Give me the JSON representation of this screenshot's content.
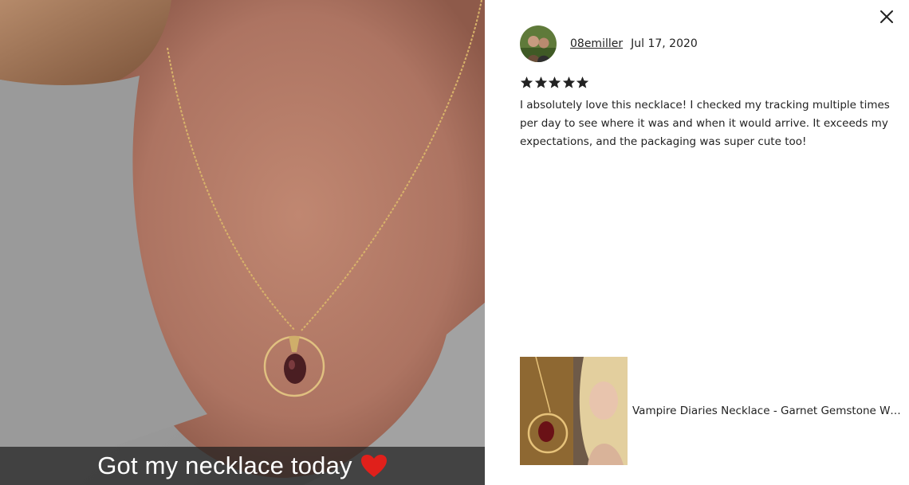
{
  "photo": {
    "caption": "Got my necklace today",
    "caption_emoji_icon": "red-heart-icon",
    "caption_colors": {
      "bar": "#1e1e1e",
      "text": "#ffffff",
      "heart": "#e0201b"
    }
  },
  "review": {
    "close_icon": "close-icon",
    "reviewer_name": "08emiller",
    "date": "Jul 17, 2020",
    "rating": 5,
    "rating_max": 5,
    "text": "I absolutely love this necklace! I checked my tracking multiple times per day to see where it was and when it would arrive. It exceeds my expectations, and the packaging was super cute too!"
  },
  "listing": {
    "title": "Vampire Diaries Necklace - Garnet Gemstone Wire Wrapped Ring Necklace"
  },
  "colors": {
    "text": "#222222",
    "background": "#ffffff",
    "star": "#222222"
  }
}
